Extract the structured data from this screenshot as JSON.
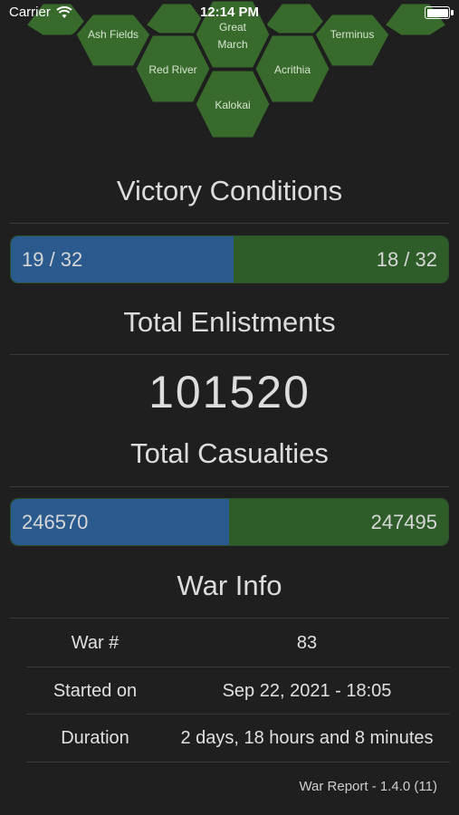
{
  "status": {
    "carrier": "Carrier",
    "time": "12:14 PM"
  },
  "map": {
    "regions": [
      {
        "name": "Ash Fields"
      },
      {
        "name": "Great March"
      },
      {
        "name": "Terminus"
      },
      {
        "name": "Red River"
      },
      {
        "name": "Acrithia"
      },
      {
        "name": "Kalokai"
      }
    ],
    "hex_color": "#386a2c"
  },
  "victory": {
    "title": "Victory Conditions",
    "left": "19 / 32",
    "right": "18 / 32",
    "left_fraction": 0.51
  },
  "enlistments": {
    "title": "Total Enlistments",
    "value": "101520"
  },
  "casualties": {
    "title": "Total Casualties",
    "left": "246570",
    "right": "247495",
    "left_fraction": 0.499
  },
  "war_info": {
    "title": "War Info",
    "rows": [
      {
        "label": "War #",
        "value": "83"
      },
      {
        "label": "Started on",
        "value": "Sep 22, 2021 - 18:05"
      },
      {
        "label": "Duration",
        "value": "2 days, 18 hours and 8 minutes"
      }
    ]
  },
  "footer": "War Report - 1.4.0 (11)",
  "colors": {
    "blue": "#2a5a8e",
    "green": "#2f5d2a",
    "background": "#1f1f1f"
  }
}
